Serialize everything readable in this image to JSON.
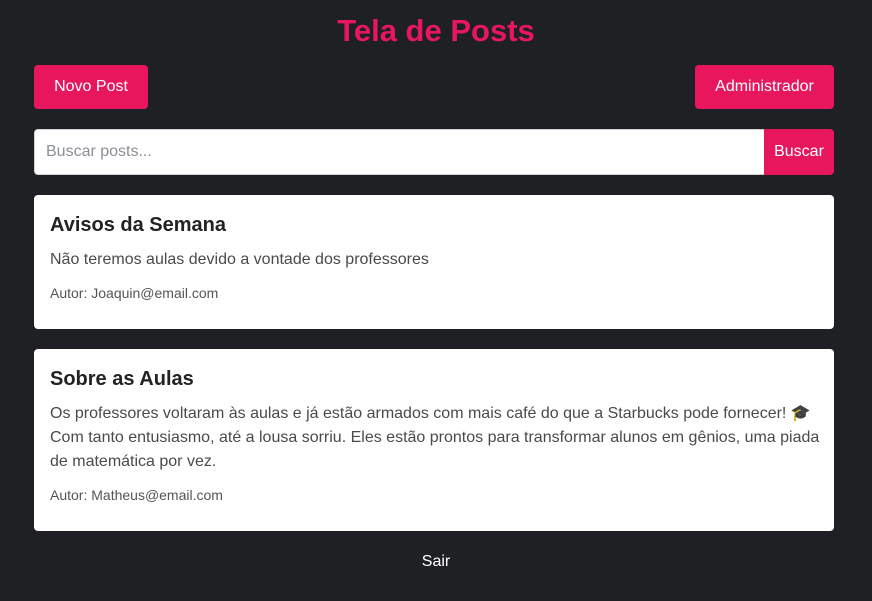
{
  "header": {
    "title": "Tela de Posts",
    "title_color": "#e8175d"
  },
  "toolbar": {
    "new_post_label": "Novo Post",
    "admin_label": "Administrador"
  },
  "search": {
    "placeholder": "Buscar posts...",
    "value": "",
    "button_label": "Buscar"
  },
  "posts": [
    {
      "title": "Avisos da Semana",
      "content": "Não teremos aulas devido a vontade dos professores",
      "author": "Autor: Joaquin@email.com"
    },
    {
      "title": "Sobre as Aulas",
      "content": "Os professores voltaram às aulas e já estão armados com mais café do que a Starbucks pode fornecer! 🎓 Com tanto entusiasmo, até a lousa sorriu. Eles estão prontos para transformar alunos em gênios, uma piada de matemática por vez.",
      "author": "Autor: Matheus@email.com"
    }
  ],
  "footer": {
    "logout_label": "Sair"
  },
  "colors": {
    "accent": "#e8175d",
    "background": "#1e2024",
    "card": "#ffffff"
  }
}
